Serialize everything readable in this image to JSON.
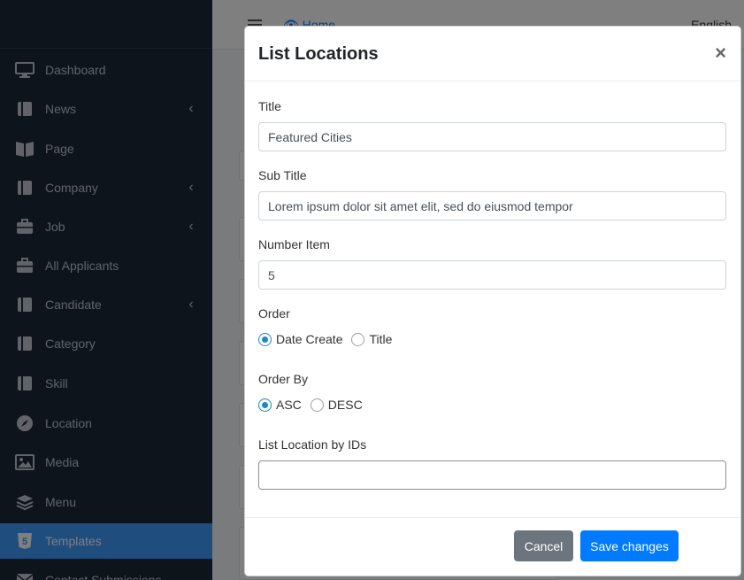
{
  "sidebar": {
    "items": [
      {
        "label": "Dashboard",
        "icon": "monitor-icon",
        "has_children": false
      },
      {
        "label": "News",
        "icon": "book-icon",
        "has_children": true
      },
      {
        "label": "Page",
        "icon": "pages-icon",
        "has_children": false
      },
      {
        "label": "Company",
        "icon": "book-icon",
        "has_children": true
      },
      {
        "label": "Job",
        "icon": "briefcase-icon",
        "has_children": true
      },
      {
        "label": "All Applicants",
        "icon": "briefcase-icon",
        "has_children": false
      },
      {
        "label": "Candidate",
        "icon": "book-icon",
        "has_children": true
      },
      {
        "label": "Category",
        "icon": "book-icon",
        "has_children": false
      },
      {
        "label": "Skill",
        "icon": "book-icon",
        "has_children": false
      },
      {
        "label": "Location",
        "icon": "compass-icon",
        "has_children": false
      },
      {
        "label": "Media",
        "icon": "image-icon",
        "has_children": false
      },
      {
        "label": "Menu",
        "icon": "layers-icon",
        "has_children": false
      },
      {
        "label": "Templates",
        "icon": "html5-icon",
        "has_children": false,
        "active": true
      },
      {
        "label": "Contact Submissions",
        "icon": "envelope-icon",
        "has_children": false
      }
    ]
  },
  "topbar": {
    "home_label": "Home",
    "language_label": "English"
  },
  "modal": {
    "title": "List Locations",
    "close_symbol": "×",
    "fields": {
      "title_label": "Title",
      "title_value": "Featured Cities",
      "subtitle_label": "Sub Title",
      "subtitle_value": "Lorem ipsum dolor sit amet elit, sed do eiusmod tempor",
      "number_label": "Number Item",
      "number_value": "5",
      "order_label": "Order",
      "order_options": [
        "Date Create",
        "Title"
      ],
      "order_selected": "Date Create",
      "orderby_label": "Order By",
      "orderby_options": [
        "ASC",
        "DESC"
      ],
      "orderby_selected": "ASC",
      "ids_label": "List Location by IDs",
      "ids_value": ""
    },
    "buttons": {
      "cancel": "Cancel",
      "save": "Save changes"
    }
  },
  "colors": {
    "sidebar_bg": "#1b2838",
    "active_item": "#3f9bfd",
    "primary": "#007bff",
    "secondary": "#6c757d"
  }
}
